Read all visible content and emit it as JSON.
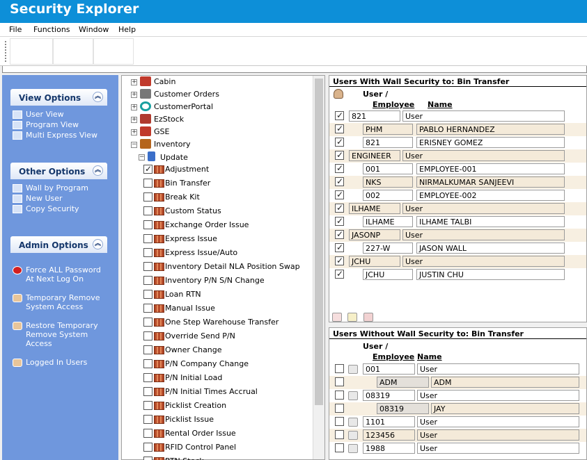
{
  "app": {
    "title": "Security Explorer"
  },
  "menu": [
    "File",
    "Functions",
    "Window",
    "Help"
  ],
  "left": {
    "view": {
      "title": "View Options",
      "items": [
        "User View",
        "Program View",
        "Multi Express View"
      ]
    },
    "other": {
      "title": "Other Options",
      "items": [
        "Wall by Program",
        "New User",
        "Copy Security"
      ]
    },
    "admin": {
      "title": "Admin Options",
      "items": [
        "Force ALL Password\n  At Next Log On",
        "Temporary Remove\n  System Access",
        "Restore Temporary\n  Remove System\n  Access",
        "Logged In Users"
      ]
    }
  },
  "tree": {
    "top": [
      {
        "label": "Cabin",
        "icon": "cabin-icon"
      },
      {
        "label": "Customer Orders",
        "icon": "customer-orders-icon"
      },
      {
        "label": "CustomerPortal",
        "icon": "portal-icon"
      },
      {
        "label": "EzStock",
        "icon": "ezstock-icon"
      },
      {
        "label": "GSE",
        "icon": "gse-icon"
      },
      {
        "label": "Inventory",
        "icon": "inventory-icon"
      }
    ],
    "update": "Update",
    "items": [
      {
        "label": "Adjustment",
        "checked": true
      },
      {
        "label": "Bin Transfer",
        "checked": false
      },
      {
        "label": "Break Kit",
        "checked": false
      },
      {
        "label": "Custom Status",
        "checked": false
      },
      {
        "label": "Exchange Order Issue",
        "checked": false
      },
      {
        "label": "Express Issue",
        "checked": false
      },
      {
        "label": "Express Issue/Auto",
        "checked": false
      },
      {
        "label": "Inventory Detail NLA Position Swap",
        "checked": false
      },
      {
        "label": "Inventory P/N S/N Change",
        "checked": false
      },
      {
        "label": "Loan RTN",
        "checked": false
      },
      {
        "label": "Manual Issue",
        "checked": false
      },
      {
        "label": "One Step Warehouse Transfer",
        "checked": false
      },
      {
        "label": "Override Send P/N",
        "checked": false
      },
      {
        "label": "Owner Change",
        "checked": false
      },
      {
        "label": "P/N Company Change",
        "checked": false
      },
      {
        "label": "P/N Initial Load",
        "checked": false
      },
      {
        "label": "P/N Initial Times Accrual",
        "checked": false
      },
      {
        "label": "Picklist Creation",
        "checked": false
      },
      {
        "label": "Picklist Issue",
        "checked": false
      },
      {
        "label": "Rental Order Issue",
        "checked": false
      },
      {
        "label": "RFID Control Panel",
        "checked": false
      },
      {
        "label": "RTN Stock",
        "checked": false
      }
    ]
  },
  "with": {
    "title": "Users With Wall Security to: Bin Transfer",
    "col_user": "User /",
    "col_employee": "Employee",
    "col_name": "Name",
    "rows": [
      {
        "level": "user",
        "code": "821",
        "name": "User",
        "checked": true
      },
      {
        "level": "emp",
        "code": "PHM",
        "name": "PABLO HERNANDEZ",
        "checked": true
      },
      {
        "level": "emp",
        "code": "821",
        "name": "ERISNEY GOMEZ",
        "checked": true
      },
      {
        "level": "user",
        "code": "ENGINEER",
        "name": "User",
        "checked": true
      },
      {
        "level": "emp",
        "code": "001",
        "name": "EMPLOYEE-001",
        "checked": true
      },
      {
        "level": "emp",
        "code": "NKS",
        "name": "NIRMALKUMAR SANJEEVI",
        "checked": true
      },
      {
        "level": "emp",
        "code": "002",
        "name": "EMPLOYEE-002",
        "checked": true
      },
      {
        "level": "user",
        "code": "ILHAME",
        "name": "User",
        "checked": true
      },
      {
        "level": "emp",
        "code": "ILHAME",
        "name": "ILHAME TALBI",
        "checked": true
      },
      {
        "level": "user",
        "code": "JASONP",
        "name": "User",
        "checked": true
      },
      {
        "level": "emp",
        "code": "227-W",
        "name": "JASON WALL",
        "checked": true
      },
      {
        "level": "user",
        "code": "JCHU",
        "name": "User",
        "checked": true
      },
      {
        "level": "emp",
        "code": "JCHU",
        "name": "JUSTIN CHU",
        "checked": true
      }
    ]
  },
  "without": {
    "title": "Users Without Wall Security to: Bin Transfer",
    "col_user": "User /",
    "col_employee": "Employee",
    "col_name": "Name",
    "rows": [
      {
        "level": "user",
        "code": "001",
        "name": "User"
      },
      {
        "level": "emp",
        "code": "ADM",
        "name": "ADM"
      },
      {
        "level": "user",
        "code": "08319",
        "name": "User"
      },
      {
        "level": "emp",
        "code": "08319",
        "name": "JAY"
      },
      {
        "level": "user",
        "code": "1101",
        "name": "User"
      },
      {
        "level": "user",
        "code": "123456",
        "name": "User"
      },
      {
        "level": "user",
        "code": "1988",
        "name": "User"
      }
    ]
  }
}
